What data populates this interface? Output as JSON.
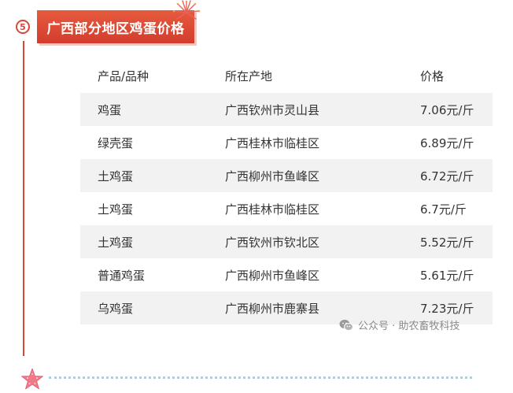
{
  "section": {
    "number": "5",
    "title": "广西部分地区鸡蛋价格"
  },
  "table": {
    "headers": [
      "产品/品种",
      "所在产地",
      "价格"
    ],
    "rows": [
      [
        "鸡蛋",
        "广西钦州市灵山县",
        "7.06元/斤"
      ],
      [
        "绿壳蛋",
        "广西桂林市临桂区",
        "6.89元/斤"
      ],
      [
        "土鸡蛋",
        "广西柳州市鱼峰区",
        "6.72元/斤"
      ],
      [
        "土鸡蛋",
        "广西桂林市临桂区",
        "6.7元/斤"
      ],
      [
        "土鸡蛋",
        "广西钦州市钦北区",
        "5.52元/斤"
      ],
      [
        "普通鸡蛋",
        "广西柳州市鱼峰区",
        "5.61元/斤"
      ],
      [
        "乌鸡蛋",
        "广西柳州市鹿寨县",
        "7.23元/斤"
      ]
    ]
  },
  "watermark": {
    "text": "公众号 · 助农畜牧科技",
    "icon": "wechat-icon"
  },
  "decorations": {
    "firework_icon": "firework-icon",
    "starfish_icon": "starfish-icon"
  },
  "colors": {
    "accent": "#d9473a",
    "row_shade": "#f2f2f2",
    "dotted_line": "#a9cfe4",
    "starfish": "#f07a8a"
  }
}
